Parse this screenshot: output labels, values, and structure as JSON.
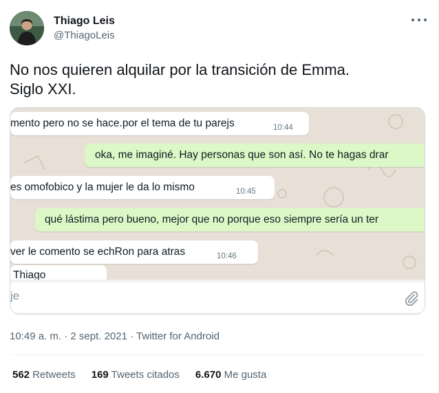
{
  "author": {
    "name": "Thiago Leis",
    "handle": "@ThiagoLeis",
    "avatar_icon": "avatar-photo"
  },
  "tweet": {
    "text": "No nos quieren alquilar por la transición de Emma.\nSiglo XXI."
  },
  "chat": {
    "messages": [
      {
        "side": "in",
        "text": "mento pero no se hace.por el tema de tu parejs",
        "time": "10:44"
      },
      {
        "side": "out",
        "text": "oka, me imaginé. Hay personas que son así. No te hagas drar",
        "time": ""
      },
      {
        "side": "in",
        "text": "es omofobico y la mujer le da lo mismo",
        "time": "10:45"
      },
      {
        "side": "out",
        "text": "qué lástima pero bueno, mejor que no porque eso siempre sería un ter",
        "time": ""
      },
      {
        "side": "in",
        "text": "ver le comento se echRon para atras",
        "time": "10:46"
      },
      {
        "side": "in",
        "text": "​ Thiago",
        "time": ""
      }
    ],
    "input_placeholder": "je",
    "attach_icon": "paperclip-icon"
  },
  "meta": {
    "time": "10:49 a. m.",
    "separator": " · ",
    "date": "2 sept. 2021",
    "source": "Twitter for Android"
  },
  "stats": {
    "retweets_count": "562",
    "retweets_label": "Retweets",
    "quotes_count": "169",
    "quotes_label": "Tweets citados",
    "likes_count": "6.670",
    "likes_label": "Me gusta"
  },
  "colors": {
    "outgoing_bubble": "#dcf8c6",
    "incoming_bubble": "#ffffff",
    "chat_wallpaper": "#e8dfd6",
    "secondary_text": "#536471"
  }
}
